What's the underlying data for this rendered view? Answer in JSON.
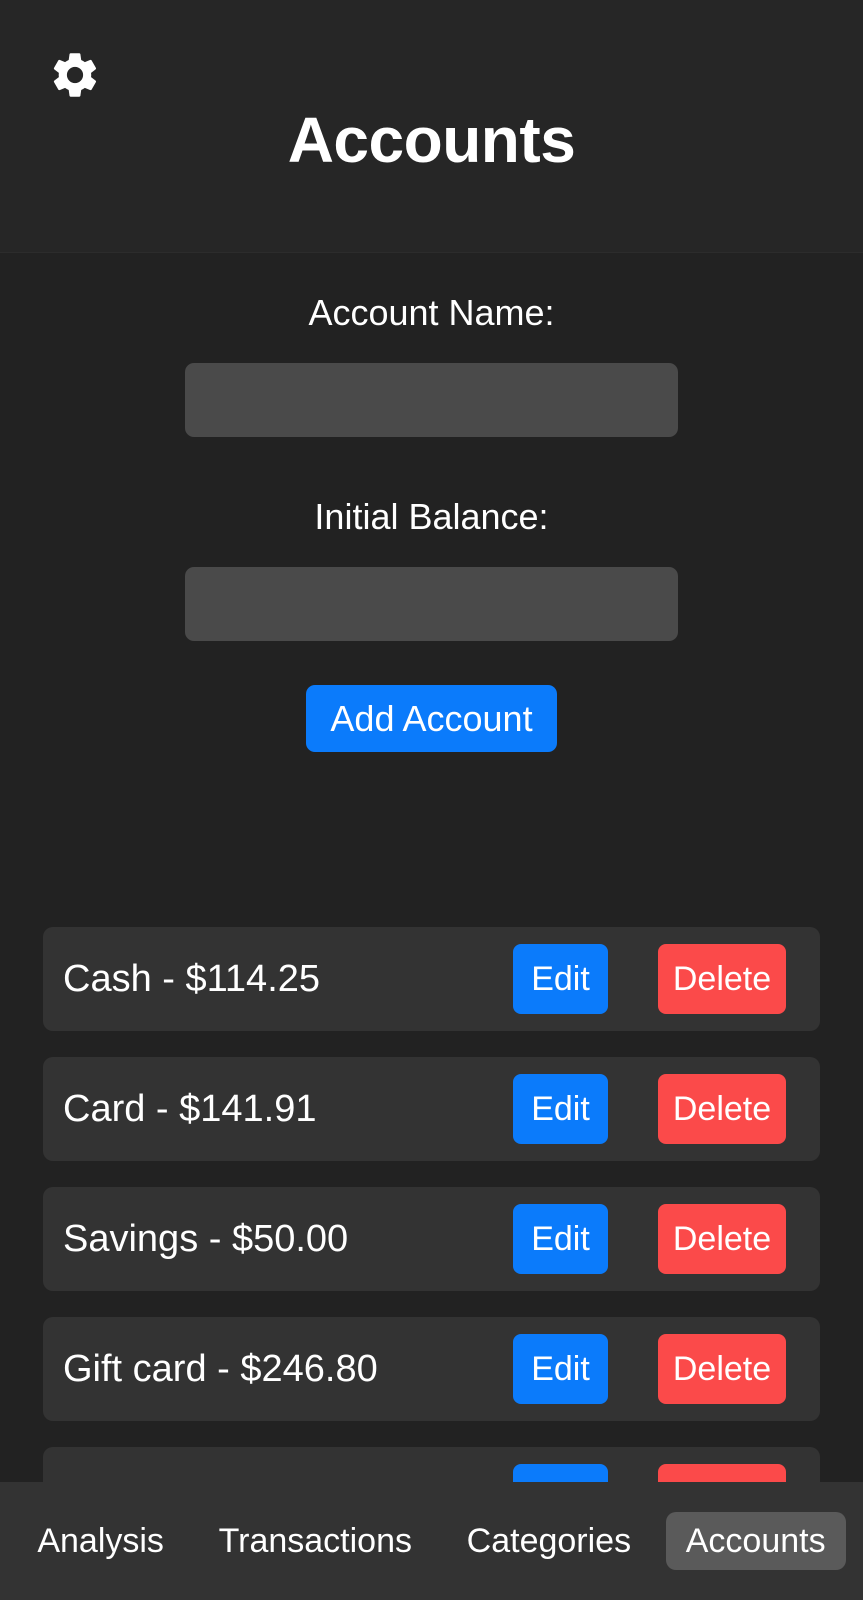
{
  "header": {
    "title": "Accounts",
    "settings_icon": "gear-icon"
  },
  "form": {
    "account_name_label": "Account Name:",
    "account_name_value": "",
    "account_name_placeholder": "",
    "initial_balance_label": "Initial Balance:",
    "initial_balance_value": "",
    "initial_balance_placeholder": "",
    "add_button_label": "Add Account"
  },
  "row_actions": {
    "edit_label": "Edit",
    "delete_label": "Delete"
  },
  "accounts": [
    {
      "label": "Cash - $114.25",
      "name": "Cash",
      "balance": "$114.25"
    },
    {
      "label": "Card - $141.91",
      "name": "Card",
      "balance": "$141.91"
    },
    {
      "label": "Savings - $50.00",
      "name": "Savings",
      "balance": "$50.00"
    },
    {
      "label": "Gift card - $246.80",
      "name": "Gift card",
      "balance": "$246.80"
    },
    {
      "label": "",
      "name": "",
      "balance": ""
    }
  ],
  "bottom_nav": {
    "tabs": [
      {
        "label": "Analysis",
        "active": false
      },
      {
        "label": "Transactions",
        "active": false
      },
      {
        "label": "Categories",
        "active": false
      },
      {
        "label": "Accounts",
        "active": true
      }
    ]
  },
  "colors": {
    "background": "#222222",
    "header_background": "#262626",
    "row_background": "#333333",
    "input_background": "#4a4a4a",
    "accent_blue": "#0b7bfb",
    "danger_red": "#fb4a4a",
    "nav_background": "#333333",
    "nav_active": "#5a5a5a",
    "text": "#ffffff"
  }
}
